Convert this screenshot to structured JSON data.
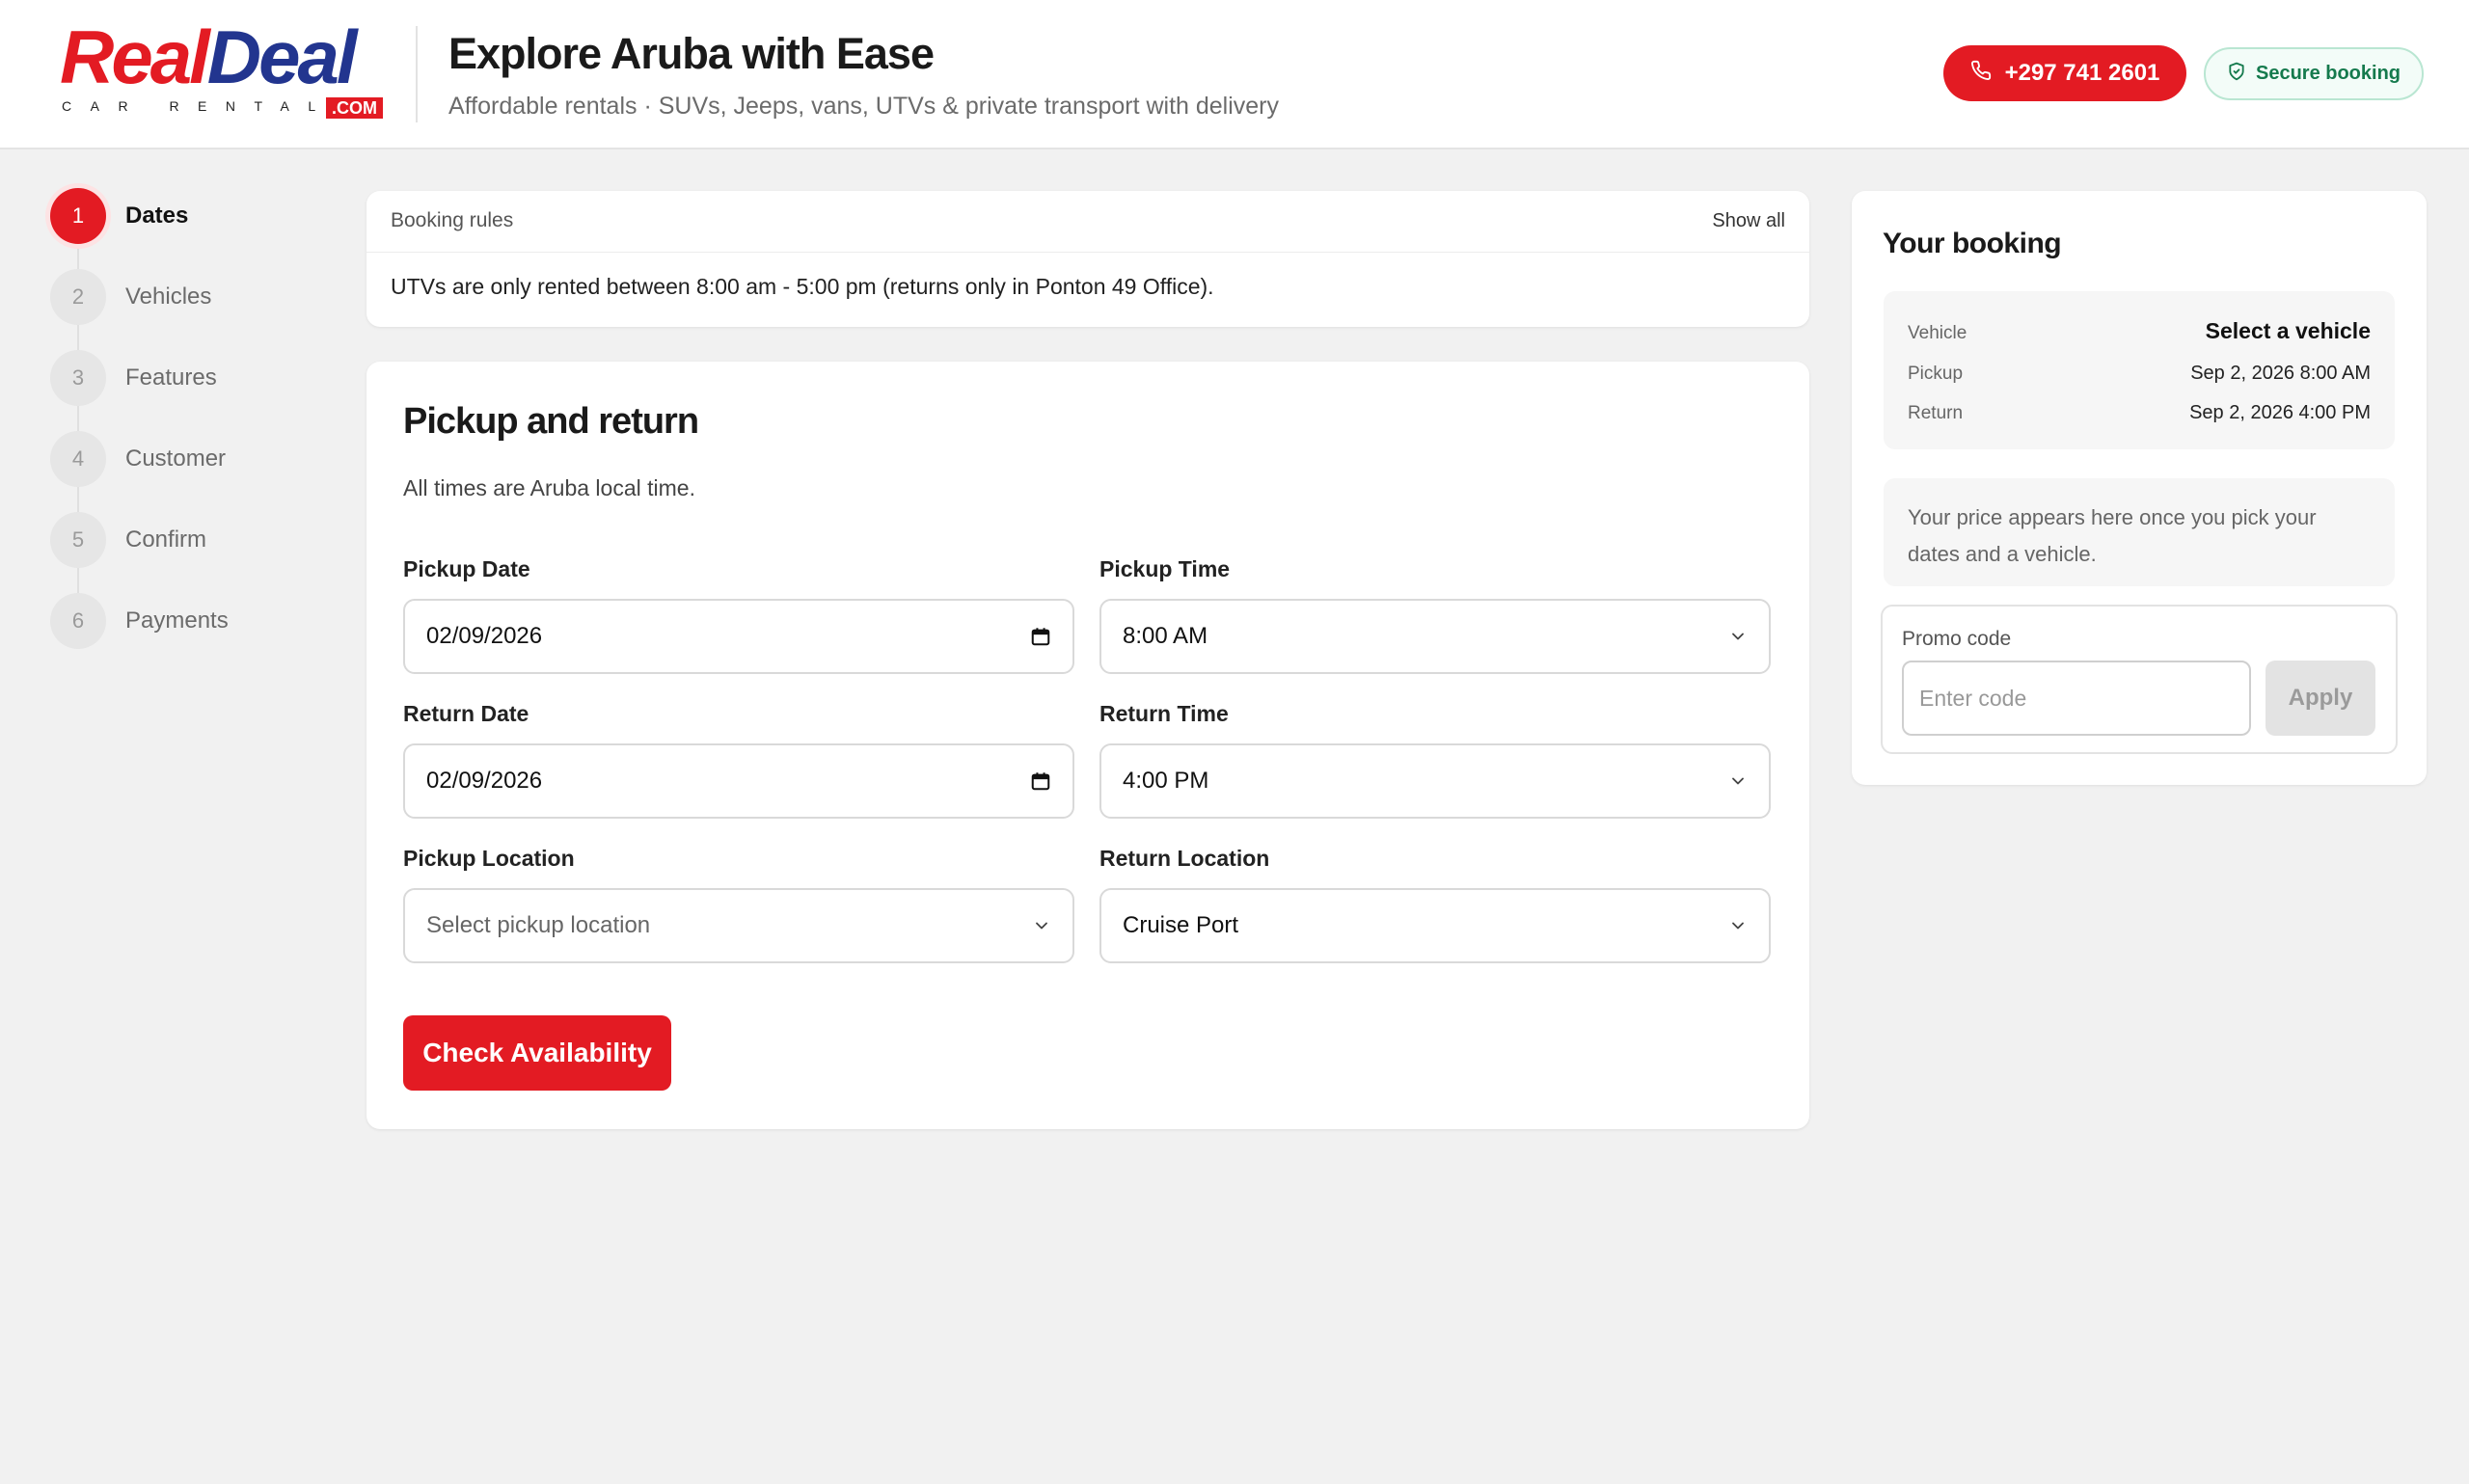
{
  "brand": {
    "logo_word_1": "Real",
    "logo_word_2": "Deal",
    "logo_tagline": "CAR RENTAL",
    "logo_com": ".COM",
    "red": "#e31b23",
    "navy": "#22358f"
  },
  "header": {
    "title": "Explore Aruba with Ease",
    "subtitle": "Affordable rentals · SUVs, Jeeps, vans, UTVs & private transport with delivery",
    "phone": "+297 741 2601",
    "secure_label": "Secure booking"
  },
  "steps": [
    {
      "number": "1",
      "label": "Dates"
    },
    {
      "number": "2",
      "label": "Vehicles"
    },
    {
      "number": "3",
      "label": "Features"
    },
    {
      "number": "4",
      "label": "Customer"
    },
    {
      "number": "5",
      "label": "Confirm"
    },
    {
      "number": "6",
      "label": "Payments"
    }
  ],
  "active_step": 1,
  "rules": {
    "title": "Booking rules",
    "show_all": "Show all",
    "text": "UTVs are only rented between 8:00 am - 5:00 pm (returns only in Ponton 49 Office)."
  },
  "form": {
    "title": "Pickup and return",
    "note": "All times are Aruba local time.",
    "pickup_date": {
      "label": "Pickup Date",
      "value": "02/09/2026"
    },
    "pickup_time": {
      "label": "Pickup Time",
      "value": "8:00 AM"
    },
    "return_date": {
      "label": "Return Date",
      "value": "02/09/2026"
    },
    "return_time": {
      "label": "Return Time",
      "value": "4:00 PM"
    },
    "pickup_location": {
      "label": "Pickup Location",
      "placeholder": "Select pickup location"
    },
    "return_location": {
      "label": "Return Location",
      "value": "Cruise Port"
    },
    "submit": "Check Availability"
  },
  "summary": {
    "title": "Your booking",
    "vehicle_key": "Vehicle",
    "vehicle_value": "Select a vehicle",
    "pickup_key": "Pickup",
    "pickup_value": "Sep 2, 2026 8:00 AM",
    "return_key": "Return",
    "return_value": "Sep 2, 2026 4:00 PM",
    "price_note": "Your price appears here once you pick your dates and a vehicle.",
    "promo_label": "Promo code",
    "promo_placeholder": "Enter code",
    "apply_label": "Apply"
  }
}
